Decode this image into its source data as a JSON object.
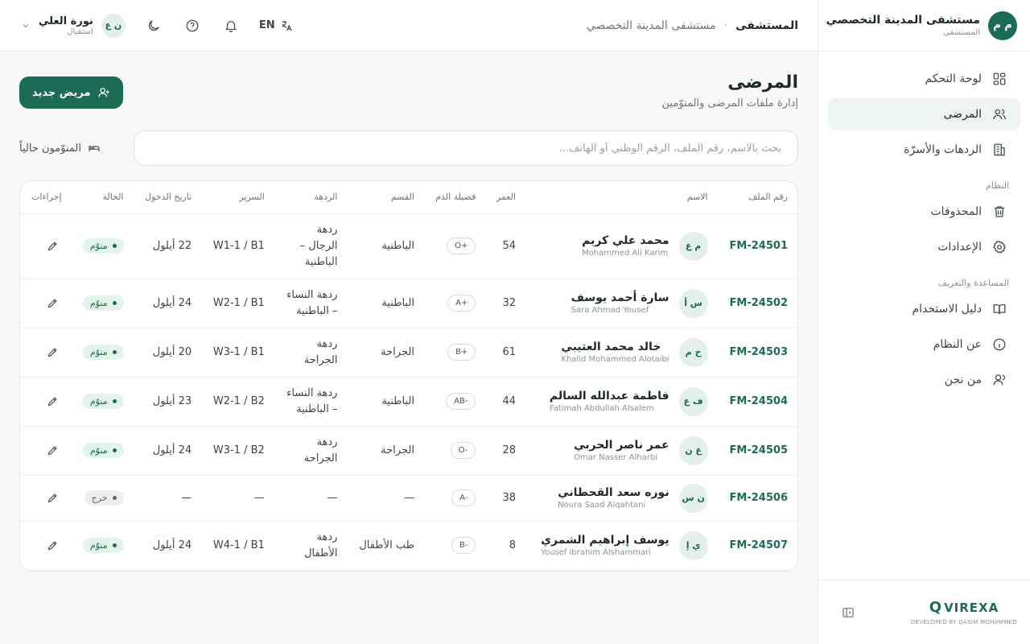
{
  "brand": {
    "initials": "م م",
    "name": "مستشفى المدينة التخصصي",
    "subtitle": "المستشفى"
  },
  "sidebar": {
    "items": [
      {
        "label": "لوحة التحكم",
        "icon": "dashboard-icon"
      },
      {
        "label": "المرضى",
        "icon": "users-icon",
        "active": true
      },
      {
        "label": "الردهات والأسرّة",
        "icon": "building-icon"
      }
    ],
    "system_section": "النظام",
    "system_items": [
      {
        "label": "المحذوفات",
        "icon": "trash-icon"
      },
      {
        "label": "الإعدادات",
        "icon": "gear-icon"
      }
    ],
    "help_section": "المساعدة والتعريف",
    "help_items": [
      {
        "label": "دليل الاستخدام",
        "icon": "book-icon"
      },
      {
        "label": "عن النظام",
        "icon": "info-icon"
      },
      {
        "label": "من نحن",
        "icon": "user-icon"
      }
    ],
    "footer": {
      "logo_text": "VIREXA",
      "credit": "DEVELOPED BY QASIM MOHAMMED"
    }
  },
  "topbar": {
    "breadcrumb_root": "المستشفى",
    "breadcrumb_current": "مستشفى المدينة التخصصي",
    "language": "EN",
    "user": {
      "initials": "ن ع",
      "name": "نورة العلي",
      "role": "استقبال"
    }
  },
  "page": {
    "title": "المرضى",
    "subtitle": "إدارة ملفات المرضى والمنوّمين",
    "new_button": "مريض جديد",
    "search_placeholder": "بحث بالاسم، رقم الملف، الرقم الوطني أو الهاتف...",
    "search_value": "",
    "inpatient_filter": "المنوّمون حالياً"
  },
  "table": {
    "headers": [
      "رقم الملف",
      "الاسم",
      "العمر",
      "فصيلة الدم",
      "القسم",
      "الردهة",
      "السرير",
      "تاريخ الدخول",
      "الحالة",
      "إجراءات"
    ],
    "rows": [
      {
        "file": "FM-24501",
        "initials": "م ع",
        "name_ar": "محمد علي كريم",
        "name_en": "Mohammed Ali Karim",
        "age": "54",
        "blood": "O+",
        "dept": "الباطنية",
        "ward": "ردهة الرجال – الباطنية",
        "bed": "W1-1 / B1",
        "date": "22 أيلول",
        "status": "منوّم",
        "status_type": "in"
      },
      {
        "file": "FM-24502",
        "initials": "س أ",
        "name_ar": "سارة أحمد يوسف",
        "name_en": "Sara Ahmad Yousef",
        "age": "32",
        "blood": "A+",
        "dept": "الباطنية",
        "ward": "ردهة النساء – الباطنية",
        "bed": "W2-1 / B1",
        "date": "24 أيلول",
        "status": "منوّم",
        "status_type": "in"
      },
      {
        "file": "FM-24503",
        "initials": "خ م",
        "name_ar": "خالد محمد العتيبي",
        "name_en": "Khalid Mohammed Alotaibi",
        "age": "61",
        "blood": "B+",
        "dept": "الجراحة",
        "ward": "ردهة الجراحة",
        "bed": "W3-1 / B1",
        "date": "20 أيلول",
        "status": "منوّم",
        "status_type": "in"
      },
      {
        "file": "FM-24504",
        "initials": "ف ع",
        "name_ar": "فاطمة عبدالله السالم",
        "name_en": "Fatimah Abdullah Alsalem",
        "age": "44",
        "blood": "AB-",
        "dept": "الباطنية",
        "ward": "ردهة النساء – الباطنية",
        "bed": "W2-1 / B2",
        "date": "23 أيلول",
        "status": "منوّم",
        "status_type": "in"
      },
      {
        "file": "FM-24505",
        "initials": "ع ن",
        "name_ar": "عمر ناصر الحربي",
        "name_en": "Omar Nasser Alharbi",
        "age": "28",
        "blood": "O-",
        "dept": "الجراحة",
        "ward": "ردهة الجراحة",
        "bed": "W3-1 / B2",
        "date": "24 أيلول",
        "status": "منوّم",
        "status_type": "in"
      },
      {
        "file": "FM-24506",
        "initials": "ن س",
        "name_ar": "نوره سعد القحطاني",
        "name_en": "Noura Saad Alqahtani",
        "age": "38",
        "blood": "A-",
        "dept": "—",
        "ward": "—",
        "bed": "—",
        "date": "—",
        "status": "خرج",
        "status_type": "out"
      },
      {
        "file": "FM-24507",
        "initials": "ي إ",
        "name_ar": "يوسف إبراهيم الشمري",
        "name_en": "Yousef Ibrahim Alshammari",
        "age": "8",
        "blood": "B-",
        "dept": "طب الأطفال",
        "ward": "ردهة الأطفال",
        "bed": "W4-1 / B1",
        "date": "24 أيلول",
        "status": "منوّم",
        "status_type": "in"
      }
    ]
  },
  "colors": {
    "accent": "#1c6b55",
    "accent_light": "#e3f1ea",
    "active_nav_bg": "#eef5f1"
  }
}
